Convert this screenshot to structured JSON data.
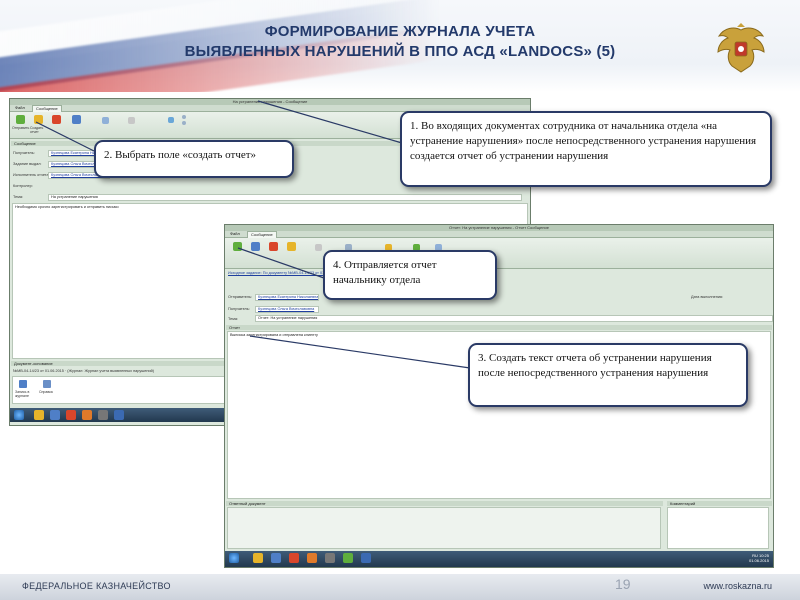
{
  "slide": {
    "title_line1": "ФОРМИРОВАНИЕ ЖУРНАЛА УЧЕТА",
    "title_line2": "ВЫЯВЛЕННЫХ НАРУШЕНИЙ В ППО АСД «LANDOCS» (5)",
    "page_number": "19",
    "footer_left": "ФЕДЕРАЛЬНОЕ КАЗНАЧЕЙСТВО",
    "footer_right": "www.roskazna.ru",
    "emblem_icon": "double-headed-eagle-emblem-icon"
  },
  "callouts": {
    "c1": "1. Во входящих документах сотрудника от начальника отдела «на устранение нарушения» после непосредственного устранения нарушения создается отчет об устранении нарушения",
    "c2": "2. Выбрать поле «создать отчет»",
    "c3": "3. Создать текст отчета об устранении нарушения после непосредственного устранения нарушения",
    "c4": "4. Отправляется отчет начальнику отдела"
  },
  "window1": {
    "title": "На устранение нарушения - Сообщение",
    "tabs": [
      "Файл",
      "Сообщение"
    ],
    "ribbon_labels": [
      "Отправить",
      "Создать отчет",
      "Удалить",
      "Свойства"
    ],
    "section": "Сообщение",
    "fields": [
      {
        "label": "Получатель:",
        "value": "Кузнецова Екатерина Николаевна"
      },
      {
        "label": "Задание выдал:",
        "value": "Кузнецова Ольга Вячеславовна"
      },
      {
        "label": "Исполнитель отчета:",
        "value": "Кузнецова Ольга Вячеславовна"
      },
      {
        "label": "Контролер:",
        "value": ""
      },
      {
        "label": "Тема:",
        "value": "На устранение нарушения"
      }
    ],
    "body_text": "Необходимо срочно зарегистрировать и отправить письмо",
    "attachments_section": "Документ-основание",
    "attachment_ref": "№МВ-04-14/23 от 01.06.2015 · (Журнал: Журнал учета выявленных нарушений)",
    "attach_items": [
      "Запись в журнале",
      "Справка"
    ]
  },
  "window2": {
    "title": "Отчет: На устранение нарушения - Отчет Сообщение",
    "tabs": [
      "Файл",
      "Сообщение"
    ],
    "task_link": "Исходное задание: По документу №МВ-04-14/23 от 01.06.2015",
    "fields": [
      {
        "label": "Отправитель:",
        "value": "Кузнецова Екатерина Николаевна"
      },
      {
        "label": "Получатель:",
        "value": "Кузнецова Ольга Вячеславовна"
      },
      {
        "label": "Тема:",
        "value": "Отчет: На устранение нарушения"
      }
    ],
    "date_label": "Дата выполнения:",
    "report_section": "Отчет",
    "report_text": "Выписка зарегистрирована и отправлена клиенту",
    "response_doc": "Ответный документ",
    "comment": "Комментарий",
    "tray_lang": "RU",
    "tray_time": "10:25",
    "tray_date": "01.06.2015"
  }
}
